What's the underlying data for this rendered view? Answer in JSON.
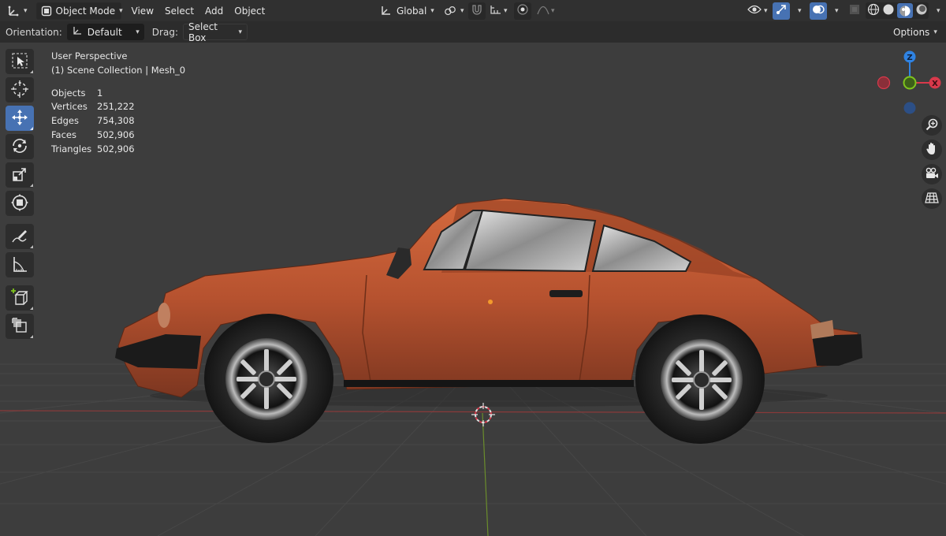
{
  "header": {
    "editor_type_icon": "axes-icon",
    "mode": "Object Mode",
    "menus": [
      "View",
      "Select",
      "Add",
      "Object"
    ],
    "transform_orientation": "Global",
    "icons": [
      "link-icon",
      "magnet-icon",
      "snap-grid-icon",
      "proportional-edit-icon",
      "falloff-icon",
      "eye-icon",
      "gizmo-icon",
      "overlay-icon",
      "xray-icon",
      "wireframe-shading-icon",
      "solid-shading-icon",
      "material-shading-icon",
      "rendered-shading-icon"
    ]
  },
  "tool_settings": {
    "orientation_label": "Orientation:",
    "orientation_value": "Default",
    "drag_label": "Drag:",
    "drag_value": "Select Box",
    "options_label": "Options"
  },
  "toolbar": {
    "tools": [
      "select-box-icon",
      "cursor-icon",
      "move-icon",
      "rotate-icon",
      "scale-icon",
      "transform-icon",
      "annotate-icon",
      "measure-icon",
      "add-cube-icon",
      "move-cube-icon"
    ],
    "active_tool": "move-icon"
  },
  "overlay": {
    "view_name": "User Perspective",
    "collection": "(1) Scene Collection | Mesh_0",
    "stats": [
      {
        "label": "Objects",
        "value": "1"
      },
      {
        "label": "Vertices",
        "value": "251,222"
      },
      {
        "label": "Edges",
        "value": "754,308"
      },
      {
        "label": "Faces",
        "value": "502,906"
      },
      {
        "label": "Triangles",
        "value": "502,906"
      }
    ]
  },
  "gizmo": {
    "z_label": "Z",
    "x_label": "X",
    "colors": {
      "x": "#d9394b",
      "y": "#7fc41d",
      "z": "#2f83e3"
    }
  },
  "nav_buttons": [
    "zoom-icon",
    "hand-pan-icon",
    "camera-icon",
    "grid-perspective-icon"
  ],
  "colors": {
    "background": "#3d3d3d",
    "header": "#303030",
    "accent": "#4772b3",
    "car_body": "#b6522f"
  }
}
